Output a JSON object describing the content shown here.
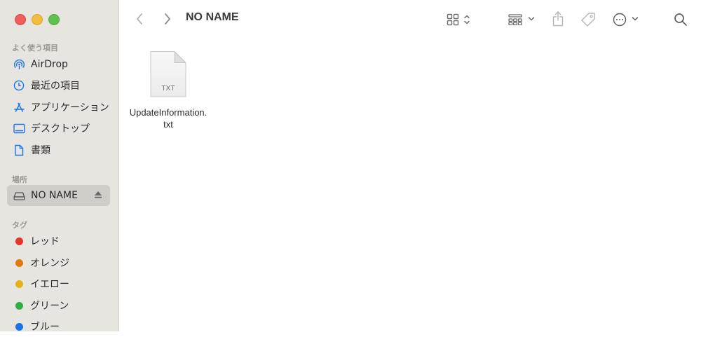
{
  "window": {
    "title": "NO NAME",
    "traffic_lights": [
      "close",
      "minimize",
      "zoom"
    ]
  },
  "sidebar": {
    "favorites_header": "よく使う項目",
    "favorites": [
      {
        "label": "AirDrop",
        "icon": "airdrop-icon"
      },
      {
        "label": "最近の項目",
        "icon": "clock-icon"
      },
      {
        "label": "アプリケーション",
        "icon": "applications-icon"
      },
      {
        "label": "デスクトップ",
        "icon": "desktop-icon"
      },
      {
        "label": "書類",
        "icon": "document-icon"
      }
    ],
    "locations_header": "場所",
    "locations": [
      {
        "label": "NO NAME",
        "icon": "drive-icon",
        "selected": true
      }
    ],
    "tags_header": "タグ",
    "tags": [
      {
        "label": "レッド",
        "color": "#e8352c"
      },
      {
        "label": "オレンジ",
        "color": "#e27a12"
      },
      {
        "label": "イエロー",
        "color": "#e6b019"
      },
      {
        "label": "グリーン",
        "color": "#2fae43"
      },
      {
        "label": "ブルー",
        "color": "#1a73e8"
      }
    ]
  },
  "toolbar": {
    "icons": [
      "back-icon",
      "forward-icon",
      "grid-view-icon",
      "group-icon",
      "share-icon",
      "tag-icon",
      "more-icon",
      "search-icon"
    ]
  },
  "files": [
    {
      "name": "UpdateInformation.txt",
      "type_label": "TXT"
    }
  ],
  "colors": {
    "accent": "#1a73e8",
    "sidebar_bg": "#e7e5e0",
    "selected_bg": "#cfcdc8"
  }
}
